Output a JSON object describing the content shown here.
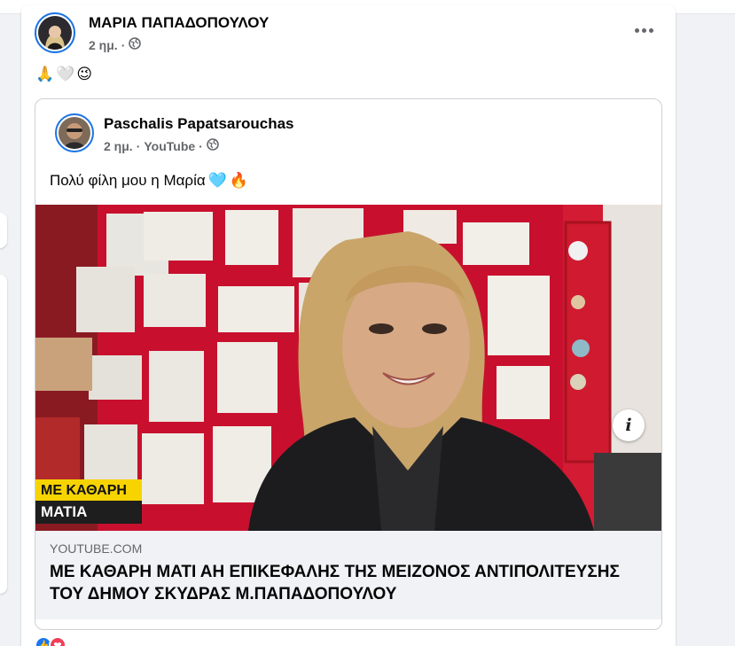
{
  "post": {
    "author": "ΜΑΡΙΑ ΠΑΠΑΔΟΠΟΥΛΟΥ",
    "time": "2 ημ.",
    "separator": "·",
    "audience_icon": "globe-icon",
    "text_emojis": [
      "🙏",
      "🤍",
      "😉"
    ],
    "more_icon": "more-options-icon"
  },
  "shared": {
    "author": "Paschalis Papatsarouchas",
    "time": "2 ημ.",
    "source": "YouTube",
    "separator": "·",
    "text": "Πολύ φίλη μου η Μαρία",
    "text_emojis": [
      "🩵",
      "🔥"
    ]
  },
  "video": {
    "caption_top": "ΜΕ ΚΑΘΑΡΗ",
    "caption_bottom": "ΜΑΤΙΑ",
    "info_label": "i"
  },
  "link": {
    "domain": "YOUTUBE.COM",
    "title": "ΜΕ ΚΑΘΑΡΗ ΜΑΤΙ ΑΗ ΕΠΙΚΕΦΑΛΗΣ ΤΗΣ ΜΕΙΖΟΝΟΣ ΑΝΤΙΠΟΛΙΤΕΥΣΗΣ ΤΟΥ ΔΗΜΟΥ ΣΚΥΔΡΑΣ Μ.ΠΑΠΑΔΟΠΟΥΛΟΥ"
  },
  "reactions": {
    "like_icon": "👍",
    "love_icon": "❤"
  },
  "colors": {
    "accent": "#1b74e4",
    "background": "#f0f2f5",
    "video_wall": "#c8102e",
    "caption_yellow": "#f7d400"
  }
}
